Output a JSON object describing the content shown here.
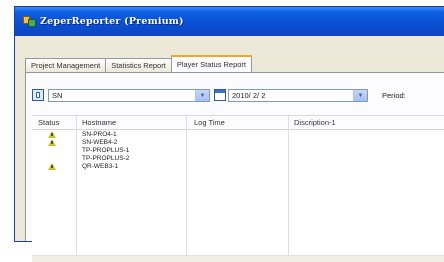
{
  "window": {
    "title": "ZeperReporter (Premium)",
    "icon": "app-icon"
  },
  "tabs": [
    {
      "label": "Project Management",
      "active": false
    },
    {
      "label": "Statistics Report",
      "active": false
    },
    {
      "label": "Player Status Report",
      "active": true
    }
  ],
  "filters": {
    "project_select": "SN",
    "date_select": "2010/ 2/ 2",
    "period_label": "Period:"
  },
  "table": {
    "columns": [
      "Status",
      "Hostname",
      "Log Time",
      "Discription-1"
    ],
    "rows": [
      {
        "status": "warning",
        "hostname": "SN-PRO4-1"
      },
      {
        "status": "warning",
        "hostname": "SN-WEB4-2"
      },
      {
        "status": "",
        "hostname": "TP-PROPLUS-1"
      },
      {
        "status": "",
        "hostname": "TP-PROPLUS-2"
      },
      {
        "status": "warning",
        "hostname": "QR-WEB3-1"
      }
    ]
  },
  "colors": {
    "titlebar": "#0b5fe3",
    "active_tab_accent": "#f0a828",
    "warning_icon": "#d0c030"
  }
}
